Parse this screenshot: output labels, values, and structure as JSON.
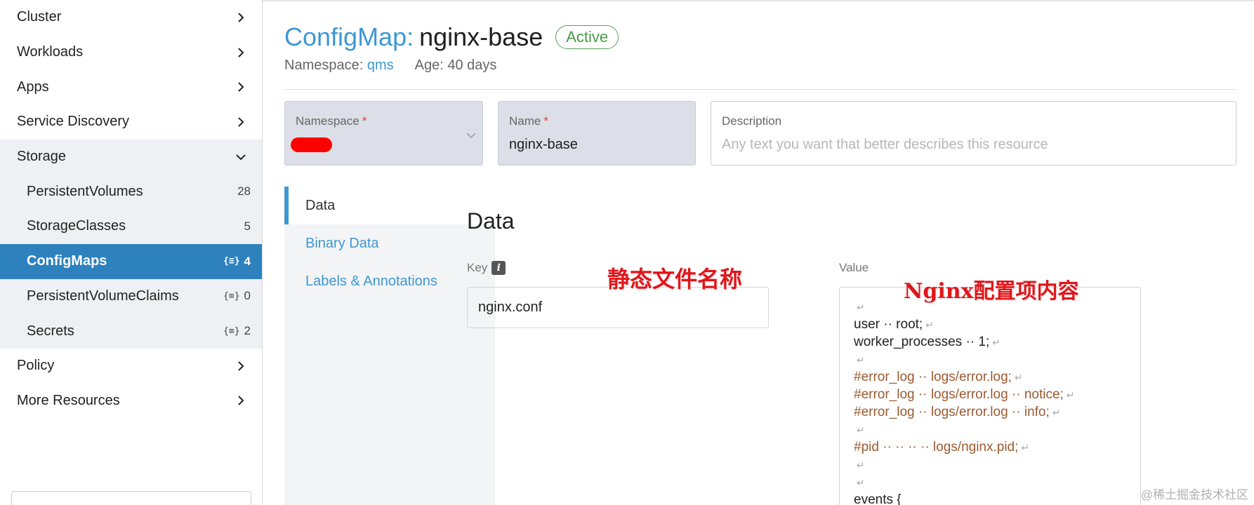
{
  "sidebar": {
    "items": [
      {
        "label": "Cluster"
      },
      {
        "label": "Workloads"
      },
      {
        "label": "Apps"
      },
      {
        "label": "Service Discovery"
      },
      {
        "label": "Storage"
      }
    ],
    "storage_children": [
      {
        "label": "PersistentVolumes",
        "count": "28"
      },
      {
        "label": "StorageClasses",
        "count": "5"
      },
      {
        "label": "ConfigMaps",
        "count": "4"
      },
      {
        "label": "PersistentVolumeClaims",
        "count": "0"
      },
      {
        "label": "Secrets",
        "count": "2"
      }
    ],
    "after": [
      {
        "label": "Policy"
      },
      {
        "label": "More Resources"
      }
    ]
  },
  "header": {
    "type": "ConfigMap:",
    "name": "nginx-base",
    "status": "Active",
    "namespace_label": "Namespace:",
    "namespace_value": "qms",
    "age": "Age: 40 days"
  },
  "form": {
    "namespace_label": "Namespace",
    "name_label": "Name",
    "name_value": "nginx-base",
    "description_label": "Description",
    "description_placeholder": "Any text you want that better describes this resource",
    "required_mark": "*"
  },
  "tabs": [
    "Data",
    "Binary Data",
    "Labels & Annotations"
  ],
  "data_section": {
    "title": "Data",
    "key_label": "Key",
    "key_value": "nginx.conf",
    "value_label": "Value",
    "value_lines": [
      {
        "text": "",
        "comment": false
      },
      {
        "text": "user ·· root;",
        "comment": false
      },
      {
        "text": "worker_processes ·· 1;",
        "comment": false
      },
      {
        "text": "",
        "comment": false
      },
      {
        "text": "#error_log ·· logs/error.log;",
        "comment": true
      },
      {
        "text": "#error_log ·· logs/error.log ·· notice;",
        "comment": true
      },
      {
        "text": "#error_log ·· logs/error.log ·· info;",
        "comment": true
      },
      {
        "text": "",
        "comment": false
      },
      {
        "text": "#pid ·· ·· ·· ·· logs/nginx.pid;",
        "comment": true
      },
      {
        "text": "",
        "comment": false
      },
      {
        "text": "",
        "comment": false
      },
      {
        "text": "events {",
        "comment": false
      }
    ]
  },
  "annotations": {
    "key_note": "静态文件名称",
    "value_note": "Nginx配置项内容"
  },
  "watermark": "@稀土掘金技术社区",
  "colors": {
    "accent": "#2d82be",
    "link": "#3d98d3",
    "status": "#4a9a4a",
    "annotation": "#e0161a"
  }
}
